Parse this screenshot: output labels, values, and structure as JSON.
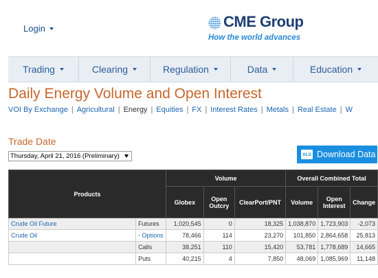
{
  "header": {
    "login_label": "Login",
    "logo_name": "CME Group",
    "logo_tagline": "How the world advances"
  },
  "nav": {
    "items": [
      {
        "label": "Trading"
      },
      {
        "label": "Clearing"
      },
      {
        "label": "Regulation"
      },
      {
        "label": "Data"
      },
      {
        "label": "Education"
      }
    ]
  },
  "page": {
    "title": "Daily Energy Volume and Open Interest",
    "subnav": [
      {
        "label": "VOI By Exchange"
      },
      {
        "label": "Agricultural"
      },
      {
        "label": "Energy"
      },
      {
        "label": "Equities"
      },
      {
        "label": "FX"
      },
      {
        "label": "Interest Rates"
      },
      {
        "label": "Metals"
      },
      {
        "label": "Real Estate"
      },
      {
        "label": "W"
      }
    ],
    "trade_date_label": "Trade Date",
    "trade_date_value": "Thursday, April 21, 2016 (Preliminary)",
    "download_label": "Download Data",
    "xls_label": "XLS"
  },
  "table": {
    "group_headers": {
      "products": "Products",
      "volume": "Volume",
      "overall": "Overall Combined Total"
    },
    "columns": {
      "globex": "Globex",
      "open_outcry": "Open Outcry",
      "clearport": "ClearPort/PNT",
      "volume": "Volume",
      "open_interest": "Open Interest",
      "change": "Change"
    },
    "rows": [
      {
        "product": "Crude Oil Future",
        "type": "Futures",
        "globex": "1,020,545",
        "open_outcry": "0",
        "clearport": "18,325",
        "volume": "1,038,870",
        "open_interest": "1,723,903",
        "change": "-2,073"
      },
      {
        "product": "Crude Oil",
        "type": "- Options",
        "globex": "78,466",
        "open_outcry": "114",
        "clearport": "23,270",
        "volume": "101,850",
        "open_interest": "2,864,658",
        "change": "25,813"
      },
      {
        "product": "",
        "type": "Calls",
        "globex": "38,251",
        "open_outcry": "110",
        "clearport": "15,420",
        "volume": "53,781",
        "open_interest": "1,778,689",
        "change": "14,665"
      },
      {
        "product": "",
        "type": "Puts",
        "globex": "40,215",
        "open_outcry": "4",
        "clearport": "7,850",
        "volume": "48,069",
        "open_interest": "1,085,969",
        "change": "11,148"
      }
    ]
  },
  "colors": {
    "accent_orange": "#c8662b",
    "link_blue": "#1a65b0",
    "button_blue": "#1a8fe0",
    "table_header": "#2a2a2a"
  }
}
